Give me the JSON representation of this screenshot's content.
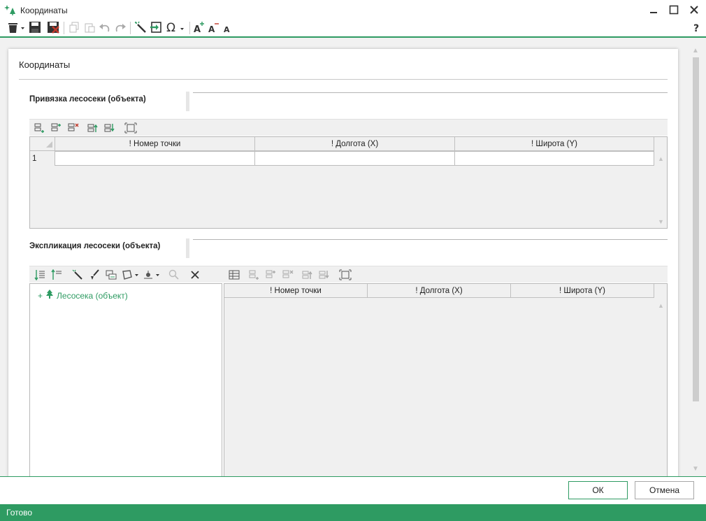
{
  "window": {
    "title": "Координаты",
    "controls": [
      "minimize-icon",
      "maximize-icon",
      "close-icon"
    ]
  },
  "toolbar": {
    "icons": [
      "delete-icon",
      "save-icon",
      "save-close-icon",
      "copy-icon",
      "paste-icon",
      "undo-icon",
      "redo-icon",
      "magic-wand-icon",
      "import-icon",
      "omega-symbol-icon",
      "font-increase-icon",
      "font-decrease-icon",
      "font-normal-icon",
      "help-icon"
    ]
  },
  "card": {
    "title": "Координаты"
  },
  "section1": {
    "title": "Привязка лесосеки (объекта)",
    "toolbar_icons": [
      "add-row-icon",
      "insert-row-icon",
      "delete-row-icon",
      "move-up-icon",
      "move-down-icon",
      "fit-icon"
    ],
    "columns": [
      "! Номер точки",
      "! Долгота (X)",
      "! Широта (Y)"
    ],
    "rows": [
      {
        "num": "1",
        "cells": [
          "",
          "",
          ""
        ]
      }
    ]
  },
  "section2": {
    "title": "Экспликация лесосеки (объекта)",
    "tree_toolbar_icons": [
      "sort-desc-icon",
      "sort-asc-icon",
      "wand-icon",
      "brush-icon",
      "layers-icon",
      "polygon-icon",
      "point-icon",
      "search-icon",
      "delete-x-icon"
    ],
    "tree": {
      "expander": "+",
      "label": "Лесосека (объект)"
    },
    "grid_toolbar_icons": [
      "table-icon",
      "add-row-icon",
      "insert-row-icon",
      "delete-row-icon",
      "move-up-icon",
      "move-down-icon",
      "fit-icon"
    ],
    "columns": [
      "! Номер точки",
      "! Долгота (X)",
      "! Широта (Y)"
    ]
  },
  "buttons": {
    "ok": "ОК",
    "cancel": "Отмена"
  },
  "status": {
    "text": "Готово"
  },
  "colors": {
    "accent": "#2e9b62",
    "danger": "#c0392b"
  }
}
